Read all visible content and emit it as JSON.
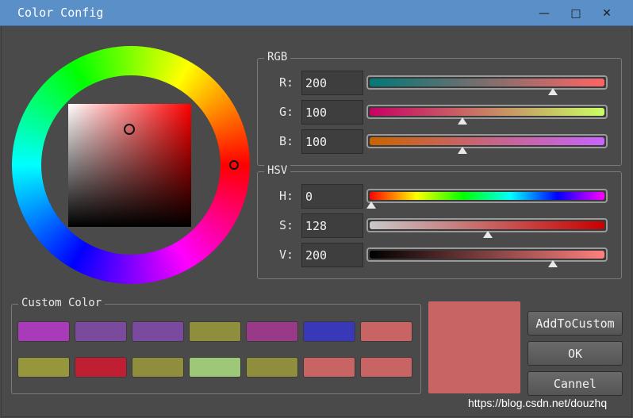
{
  "window": {
    "title": "Color Config",
    "minimize_glyph": "—",
    "maximize_glyph": "□",
    "close_glyph": "✕"
  },
  "rgb": {
    "title": "RGB",
    "rows": [
      {
        "label": "R:",
        "value": "200",
        "level": 200,
        "max": 255,
        "gradient": [
          "#007878",
          "#ff6464"
        ]
      },
      {
        "label": "G:",
        "value": "100",
        "level": 100,
        "max": 255,
        "gradient": [
          "#c80064",
          "#c8ff64"
        ]
      },
      {
        "label": "B:",
        "value": "100",
        "level": 100,
        "max": 255,
        "gradient": [
          "#c86400",
          "#c864ff"
        ]
      }
    ]
  },
  "hsv": {
    "title": "HSV",
    "rows": [
      {
        "label": "H:",
        "value": "0",
        "level": 0,
        "max": 359,
        "gradient": [
          "#ff0000",
          "#ffff00",
          "#00ff00",
          "#00ffff",
          "#0000ff",
          "#ff00ff"
        ]
      },
      {
        "label": "S:",
        "value": "128",
        "level": 128,
        "max": 255,
        "gradient": [
          "#c8c8c8",
          "#c80000"
        ]
      },
      {
        "label": "V:",
        "value": "200",
        "level": 200,
        "max": 255,
        "gradient": [
          "#000000",
          "#ff8080"
        ]
      }
    ]
  },
  "custom": {
    "title": "Custom Color",
    "rows": [
      [
        "#a83cb8",
        "#7a4a9c",
        "#7a4a9e",
        "#8e8e3c",
        "#983a88",
        "#3838b8",
        "#c86464"
      ],
      [
        "#96963c",
        "#c01e32",
        "#8e8e3c",
        "#9cc878",
        "#8e8e3c",
        "#c86464",
        "#c86464"
      ]
    ]
  },
  "preview_color": "#c86464",
  "buttons": {
    "add": "AddToCustom",
    "ok": "OK",
    "cancel": "Cannel"
  },
  "watermark": "https://blog.csdn.net/douzhq"
}
